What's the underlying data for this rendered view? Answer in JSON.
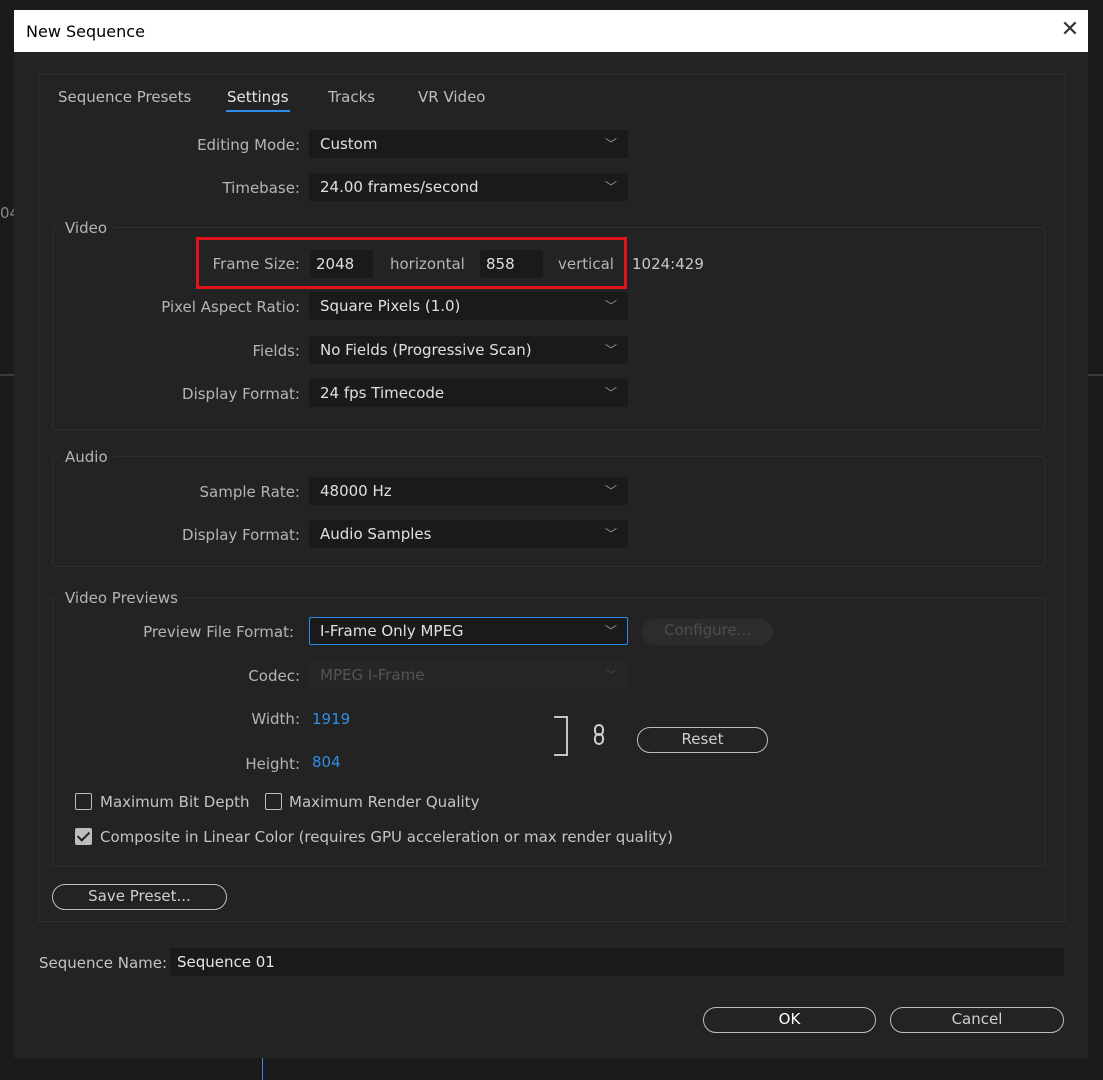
{
  "window": {
    "title": "New Sequence",
    "close_glyph": "✕"
  },
  "background": {
    "left_text": "04"
  },
  "tabs": [
    {
      "label": "Sequence Presets",
      "active": false
    },
    {
      "label": "Settings",
      "active": true
    },
    {
      "label": "Tracks",
      "active": false
    },
    {
      "label": "VR Video",
      "active": false
    }
  ],
  "editing_mode": {
    "label": "Editing Mode:",
    "value": "Custom"
  },
  "timebase": {
    "label": "Timebase:",
    "value": "24.00  frames/second"
  },
  "video": {
    "group_title": "Video",
    "frame_size": {
      "label": "Frame Size:",
      "horizontal_value": "2048",
      "horizontal_label": "horizontal",
      "vertical_value": "858",
      "vertical_label": "vertical",
      "aspect": "1024:429"
    },
    "pixel_aspect": {
      "label": "Pixel Aspect Ratio:",
      "value": "Square Pixels (1.0)"
    },
    "fields": {
      "label": "Fields:",
      "value": "No Fields (Progressive Scan)"
    },
    "display_format": {
      "label": "Display Format:",
      "value": "24 fps Timecode"
    }
  },
  "audio": {
    "group_title": "Audio",
    "sample_rate": {
      "label": "Sample Rate:",
      "value": "48000 Hz"
    },
    "display_format": {
      "label": "Display Format:",
      "value": "Audio Samples"
    }
  },
  "video_previews": {
    "group_title": "Video Previews",
    "preview_format": {
      "label": "Preview File Format:",
      "value": "I-Frame Only MPEG"
    },
    "configure_label": "Configure...",
    "codec": {
      "label": "Codec:",
      "value": "MPEG I-Frame"
    },
    "width": {
      "label": "Width:",
      "value": "1919"
    },
    "height": {
      "label": "Height:",
      "value": "804"
    },
    "reset_label": "Reset",
    "max_bit_depth": {
      "label": "Maximum Bit Depth",
      "checked": false
    },
    "max_render_quality": {
      "label": "Maximum Render Quality",
      "checked": false
    },
    "linear_color": {
      "label": "Composite in Linear Color (requires GPU acceleration or max render quality)",
      "checked": true
    }
  },
  "save_preset_label": "Save Preset...",
  "sequence_name": {
    "label": "Sequence Name:",
    "value": "Sequence 01"
  },
  "buttons": {
    "ok": "OK",
    "cancel": "Cancel"
  },
  "colors": {
    "accent": "#2d8ceb",
    "highlight_box": "#e0141b",
    "value_blue": "#2f8fe6"
  }
}
